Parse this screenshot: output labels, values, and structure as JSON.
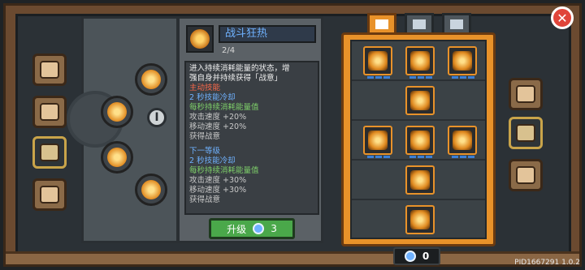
{
  "skill": {
    "title": "战斗狂热",
    "level": "2/4",
    "description_lines": [
      "进入持续消耗能量的状态，增",
      "强自身并持续获得「战意」"
    ],
    "skill_type": "主动技能",
    "current": [
      "2 秒技能冷却",
      "每秒持续消耗能量值",
      "攻击速度 +20%",
      "移动速度 +20%",
      "获得战意"
    ],
    "next_header": "下一等级",
    "next": [
      "2 秒技能冷却",
      "每秒持续消耗能量值",
      "攻击速度 +30%",
      "移动速度 +30%",
      "获得战意"
    ]
  },
  "upgrade": {
    "label": "升级",
    "cost": "3"
  },
  "tree": {
    "tier": "I"
  },
  "currency": {
    "amount": "0"
  },
  "version": "PID1667291 1.0.2",
  "close_glyph": "✕"
}
